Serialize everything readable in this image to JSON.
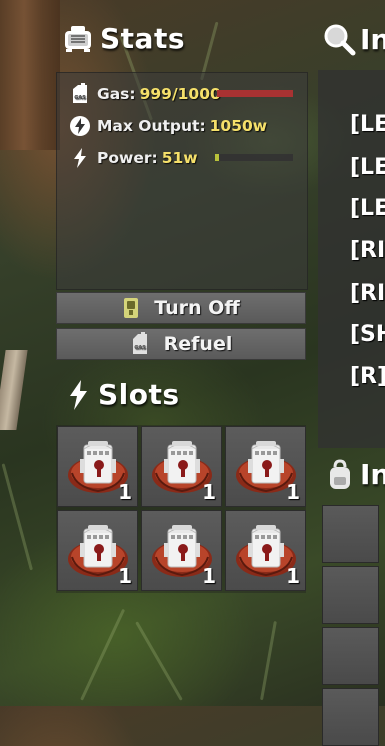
{
  "stats": {
    "title": "Stats",
    "gas_label": "Gas:",
    "gas_value": "999/1000",
    "gas_fraction": 0.999,
    "max_output_label": "Max Output:",
    "max_output_value": "1050w",
    "power_label": "Power:",
    "power_value": "51w",
    "power_fraction": 0.05
  },
  "buttons": {
    "turn_off": "Turn Off",
    "refuel": "Refuel"
  },
  "slots": {
    "title": "Slots",
    "items": [
      {
        "name": "generator-item-icon",
        "count": "1"
      },
      {
        "name": "generator-item-icon",
        "count": "1"
      },
      {
        "name": "generator-item-icon",
        "count": "1"
      },
      {
        "name": "generator-item-icon",
        "count": "1"
      },
      {
        "name": "generator-item-icon",
        "count": "1"
      },
      {
        "name": "generator-item-icon",
        "count": "1"
      }
    ]
  },
  "right_panel": {
    "title_1": "In",
    "list_items": [
      "[LEF",
      "[LEF",
      "[LEF",
      "[RIG",
      "[RIG",
      "[SH",
      "[R]"
    ],
    "title_2": "In"
  },
  "colors": {
    "gas_bar": "#a83232",
    "power_bar": "#b8c23a",
    "value_text": "#f5e06a"
  }
}
